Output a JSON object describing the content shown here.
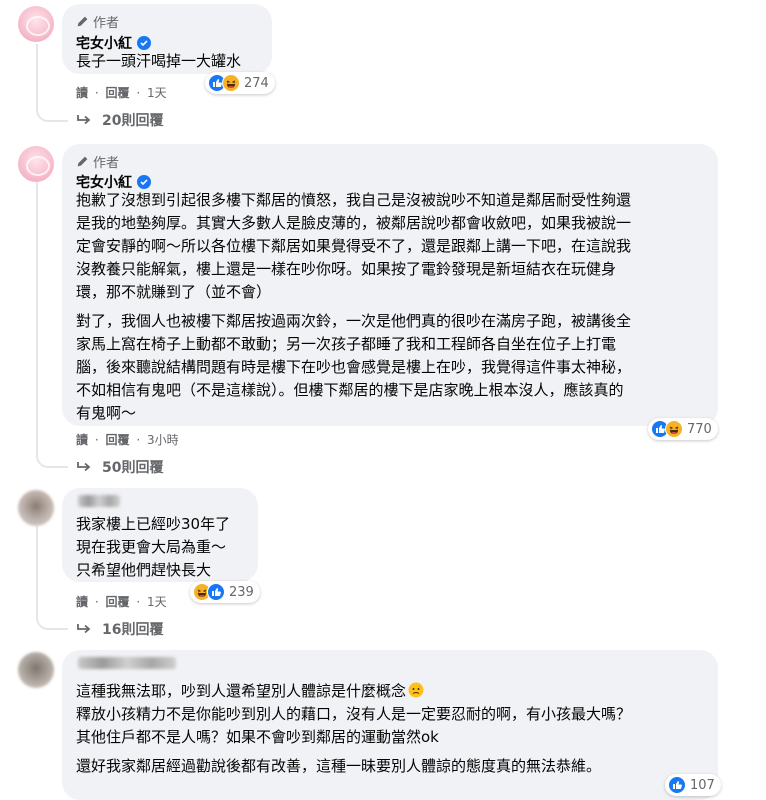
{
  "common": {
    "author_tag": "作者",
    "read_label": "讀",
    "reply_label": "回覆",
    "dot": "·"
  },
  "comments": [
    {
      "author": "宅女小紅",
      "lines": [
        "長子一頭汗喝掉一大罐水"
      ],
      "time": "1天",
      "reaction_count": "274",
      "replies": "20則回覆"
    },
    {
      "author": "宅女小紅",
      "paragraphs": [
        [
          "抱歉了沒想到引起很多樓下鄰居的憤怒，我自己是沒被說吵不知道是鄰居耐受性夠還",
          "是我的地墊夠厚。其實大多數人是臉皮薄的，被鄰居說吵都會收斂吧，如果我被說一",
          "定會安靜的啊～所以各位樓下鄰居如果覺得受不了，還是跟鄰上講一下吧，在這說我",
          "沒教養只能解氣，樓上還是一樣在吵你呀。如果按了電鈴發現是新垣結衣在玩健身",
          "環，那不就賺到了（並不會）"
        ],
        [
          "對了，我個人也被樓下鄰居按過兩次鈴，一次是他們真的很吵在滿房子跑，被講後全",
          "家馬上窩在椅子上動都不敢動；另一次孩子都睡了我和工程師各自坐在位子上打電",
          "腦，後來聽說結構問題有時是樓下在吵也會感覺是樓上在吵，我覺得這件事太神秘，",
          "不如相信有鬼吧（不是這樣說）。但樓下鄰居的樓下是店家晚上根本沒人，應該真的",
          "有鬼啊～"
        ]
      ],
      "time": "3小時",
      "reaction_count": "770",
      "replies": "50則回覆"
    },
    {
      "lines": [
        "我家樓上已經吵30年了",
        "現在我更會大局為重～",
        "只希望他們趕快長大"
      ],
      "time": "1天",
      "reaction_count": "239",
      "replies": "16則回覆"
    },
    {
      "paragraphs": [
        [
          "這種我無法耶，吵到人還希望別人體諒是什麼概念",
          "釋放小孩精力不是你能吵到別人的藉口，沒有人是一定要忍耐的啊，有小孩最大嗎？",
          "其他住戶都不是人嗎？如果不會吵到鄰居的運動當然ok"
        ],
        [
          "還好我家鄰居經過勸說後都有改善，這種一昧要別人體諒的態度真的無法恭維。"
        ]
      ],
      "reaction_count": "107"
    }
  ],
  "icons": {
    "author": "pencil-icon",
    "verified": "verified-badge-icon",
    "like": "like-reaction-icon",
    "haha": "haha-reaction-icon",
    "replies": "reply-arrow-icon",
    "emoji": "anxious-face-emoji"
  },
  "colors": {
    "bubble": "#f0f2f5",
    "meta_text": "#65676b",
    "like_blue": "#1877f2",
    "haha_yellow": "#f7b125"
  }
}
